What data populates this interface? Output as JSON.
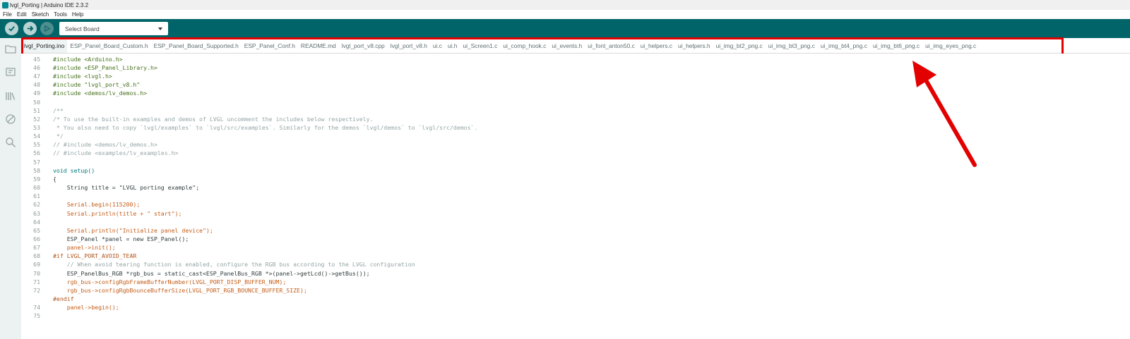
{
  "window": {
    "title": "lvgl_Porting | Arduino IDE 2.3.2"
  },
  "menu": [
    "File",
    "Edit",
    "Sketch",
    "Tools",
    "Help"
  ],
  "toolbar": {
    "verify_icon": "check-icon",
    "upload_icon": "arrow-right-icon",
    "debug_icon": "debug-icon",
    "board_select_label": "Select Board"
  },
  "sidebar": {
    "icons": [
      "folder-icon",
      "board-manager-icon",
      "library-icon",
      "debug-icon",
      "search-icon"
    ]
  },
  "tabs": [
    "lvgl_Porting.ino",
    "ESP_Panel_Board_Custom.h",
    "ESP_Panel_Board_Supported.h",
    "ESP_Panel_Conf.h",
    "README.md",
    "lvgl_port_v8.cpp",
    "lvgl_port_v8.h",
    "ui.c",
    "ui.h",
    "ui_Screen1.c",
    "ui_comp_hook.c",
    "ui_events.h",
    "ui_font_anton50.c",
    "ui_helpers.c",
    "ui_helpers.h",
    "ui_img_bt2_png.c",
    "ui_img_bt3_png.c",
    "ui_img_bt4_png.c",
    "ui_img_bt6_png.c",
    "ui_img_eyes_png.c"
  ],
  "active_tab_index": 0,
  "code": [
    {
      "n": "45",
      "t": "#include <Arduino.h>"
    },
    {
      "n": "46",
      "t": "#include <ESP_Panel_Library.h>"
    },
    {
      "n": "47",
      "t": "#include <lvgl.h>"
    },
    {
      "n": "48",
      "t": "#include \"lvgl_port_v8.h\""
    },
    {
      "n": "49",
      "t": "#include <demos/lv_demos.h>"
    },
    {
      "n": "50",
      "t": ""
    },
    {
      "n": "51",
      "t": "/**"
    },
    {
      "n": "52",
      "t": "/* To use the built-in examples and demos of LVGL uncomment the includes below respectively."
    },
    {
      "n": "53",
      "t": " * You also need to copy `lvgl/examples` to `lvgl/src/examples`. Similarly for the demos `lvgl/demos` to `lvgl/src/demos`."
    },
    {
      "n": "54",
      "t": " */"
    },
    {
      "n": "55",
      "t": "// #include <demos/lv_demos.h>"
    },
    {
      "n": "56",
      "t": "// #include <examples/lv_examples.h>"
    },
    {
      "n": "57",
      "t": ""
    },
    {
      "n": "58",
      "t": "void setup()"
    },
    {
      "n": "59",
      "t": "{"
    },
    {
      "n": "60",
      "t": "    String title = \"LVGL porting example\";"
    },
    {
      "n": "61",
      "t": ""
    },
    {
      "n": "62",
      "t": "    Serial.begin(115200);"
    },
    {
      "n": "63",
      "t": "    Serial.println(title + \" start\");"
    },
    {
      "n": "64",
      "t": ""
    },
    {
      "n": "65",
      "t": "    Serial.println(\"Initialize panel device\");"
    },
    {
      "n": "66",
      "t": "    ESP_Panel *panel = new ESP_Panel();"
    },
    {
      "n": "67",
      "t": "    panel->init();"
    },
    {
      "n": "68",
      "t": "#if LVGL_PORT_AVOID_TEAR"
    },
    {
      "n": "69",
      "t": "    // When avoid tearing function is enabled, configure the RGB bus according to the LVGL configuration"
    },
    {
      "n": "70",
      "t": "    ESP_PanelBus_RGB *rgb_bus = static_cast<ESP_PanelBus_RGB *>(panel->getLcd()->getBus());"
    },
    {
      "n": "71",
      "t": "    rgb_bus->configRgbFrameBufferNumber(LVGL_PORT_DISP_BUFFER_NUM);"
    },
    {
      "n": "72",
      "t": "    rgb_bus->configRgbBounceBufferSize(LVGL_PORT_RGB_BOUNCE_BUFFER_SIZE);"
    },
    {
      "n": "",
      "t": "#endif"
    },
    {
      "n": "74",
      "t": "    panel->begin();"
    },
    {
      "n": "75",
      "t": ""
    }
  ],
  "colors": {
    "toolbar": "#006468",
    "annotation": "#e30000",
    "sidebar": "#ecf1f1"
  }
}
